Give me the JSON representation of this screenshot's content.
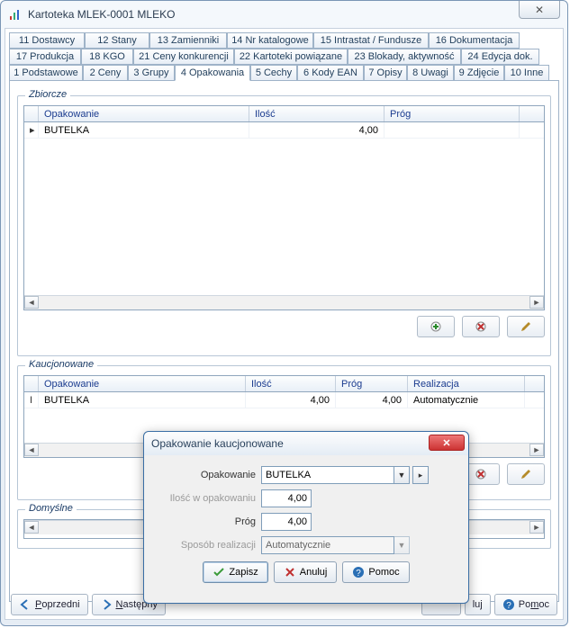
{
  "window": {
    "title": "Kartoteka  MLEK-0001  MLEKO",
    "close_glyph": "✕"
  },
  "tabsRow1": [
    {
      "label": "11 Dostawcy",
      "w": 84
    },
    {
      "label": "12 Stany",
      "w": 72
    },
    {
      "label": "13 Zamienniki",
      "w": 86
    },
    {
      "label": "14 Nr katalogowe",
      "w": 96
    },
    {
      "label": "15 Intrastat / Fundusze",
      "w": 128
    },
    {
      "label": "16 Dokumentacja",
      "w": 101
    }
  ],
  "tabsRow2": [
    {
      "label": "17 Produkcja",
      "w": 80
    },
    {
      "label": "18 KGO",
      "w": 58
    },
    {
      "label": "21 Ceny konkurencji",
      "w": 112
    },
    {
      "label": "22 Kartoteki powiązane",
      "w": 126
    },
    {
      "label": "23 Blokady, aktywność",
      "w": 126
    },
    {
      "label": "24 Edycja dok.",
      "w": 87
    }
  ],
  "tabsRow3": [
    {
      "label": "1 Podstawowe",
      "w": 82,
      "active": false
    },
    {
      "label": "2 Ceny",
      "w": 50
    },
    {
      "label": "3 Grupy",
      "w": 52
    },
    {
      "label": "4 Opakowania",
      "w": 84,
      "active": true
    },
    {
      "label": "5 Cechy",
      "w": 52
    },
    {
      "label": "6 Kody EAN",
      "w": 74
    },
    {
      "label": "7 Opisy",
      "w": 48
    },
    {
      "label": "8 Uwagi",
      "w": 52
    },
    {
      "label": "9 Zdjęcie",
      "w": 56
    },
    {
      "label": "10 Inne",
      "w": 50
    }
  ],
  "groups": {
    "zbiorcze": "Zbiorcze",
    "kaucjonowane": "Kaucjonowane",
    "domyslne": "Domyślne"
  },
  "grid1": {
    "headers": {
      "opak": "Opakowanie",
      "ilosc": "Ilość",
      "prog": "Próg"
    },
    "rows": [
      {
        "mark": "▸",
        "opak": "BUTELKA",
        "ilosc": "4,00",
        "prog": ""
      }
    ]
  },
  "grid2": {
    "headers": {
      "opak": "Opakowanie",
      "ilosc": "Ilość",
      "prog": "Próg",
      "real": "Realizacja"
    },
    "rows": [
      {
        "mark": "I",
        "opak": "BUTELKA",
        "ilosc": "4,00",
        "prog": "4,00",
        "real": "Automatycznie"
      }
    ]
  },
  "dialog": {
    "title": "Opakowanie kaucjonowane",
    "fields": {
      "opak_label": "Opakowanie",
      "opak_value": "BUTELKA",
      "ilosc_label": "Ilość w opakowaniu",
      "ilosc_value": "4,00",
      "prog_label": "Próg",
      "prog_value": "4,00",
      "real_label": "Sposób realizacji",
      "real_value": "Automatycznie"
    },
    "buttons": {
      "zapisz": "Zapisz",
      "anuluj": "Anuluj",
      "pomoc": "Pomoc"
    }
  },
  "footer": {
    "poprzedni": "Poprzedni",
    "nastepny": "Następny",
    "anuluj": "luj",
    "pomoc": "Pomoc"
  },
  "icons": {
    "add": "#2a8a2a",
    "del": "#c03030",
    "edit": "#b58b2a",
    "check": "#3a9a3a",
    "cancel": "#c03030",
    "help": "#2a6fb5",
    "prev": "#2a6fb5",
    "next": "#2a6fb5"
  }
}
